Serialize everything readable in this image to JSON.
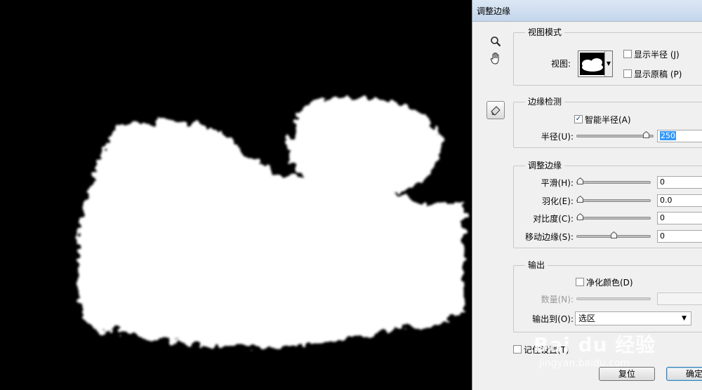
{
  "dialog": {
    "title": "调整边缘",
    "tools": {
      "zoom_icon": "magnifier-icon",
      "hand_icon": "hand-icon",
      "refine_brush_icon": "refine-radius-brush-icon"
    },
    "view_mode": {
      "title": "视图模式",
      "view_label": "视图:",
      "show_radius": {
        "label": "显示半径 (J)",
        "checked": false
      },
      "show_original": {
        "label": "显示原稿 (P)",
        "checked": false
      }
    },
    "edge_detection": {
      "title": "边缘检测",
      "smart_radius": {
        "label": "智能半径(A)",
        "checked": true
      },
      "radius": {
        "label": "半径(U):",
        "value": "250",
        "level": 0.95
      }
    },
    "adjust_edge": {
      "title": "调整边缘",
      "smooth": {
        "label": "平滑(H):",
        "value": "0",
        "level": 0.0
      },
      "feather": {
        "label": "羽化(E):",
        "value": "0.0",
        "level": 0.0
      },
      "contrast": {
        "label": "对比度(C):",
        "value": "0",
        "level": 0.0
      },
      "shift_edge": {
        "label": "移动边缘(S):",
        "value": "0",
        "level": 0.5
      }
    },
    "output": {
      "title": "输出",
      "decontaminate": {
        "label": "净化颜色(D)",
        "checked": false
      },
      "amount": {
        "label": "数量(N):",
        "value": ""
      },
      "output_to": {
        "label": "输出到(O):",
        "value": "选区"
      }
    },
    "remember": {
      "label": "记住设置(T)",
      "checked": false
    },
    "buttons": {
      "reset": "复位",
      "ok": "确定"
    }
  },
  "watermark": {
    "logo": "Bai du 经验",
    "url": "jingyan.baidu.com"
  },
  "colors": {
    "canvas_bg": "#000000",
    "mask": "#ffffff",
    "dialog_bg": "#f0f0f0",
    "selection": "#3399ff"
  }
}
